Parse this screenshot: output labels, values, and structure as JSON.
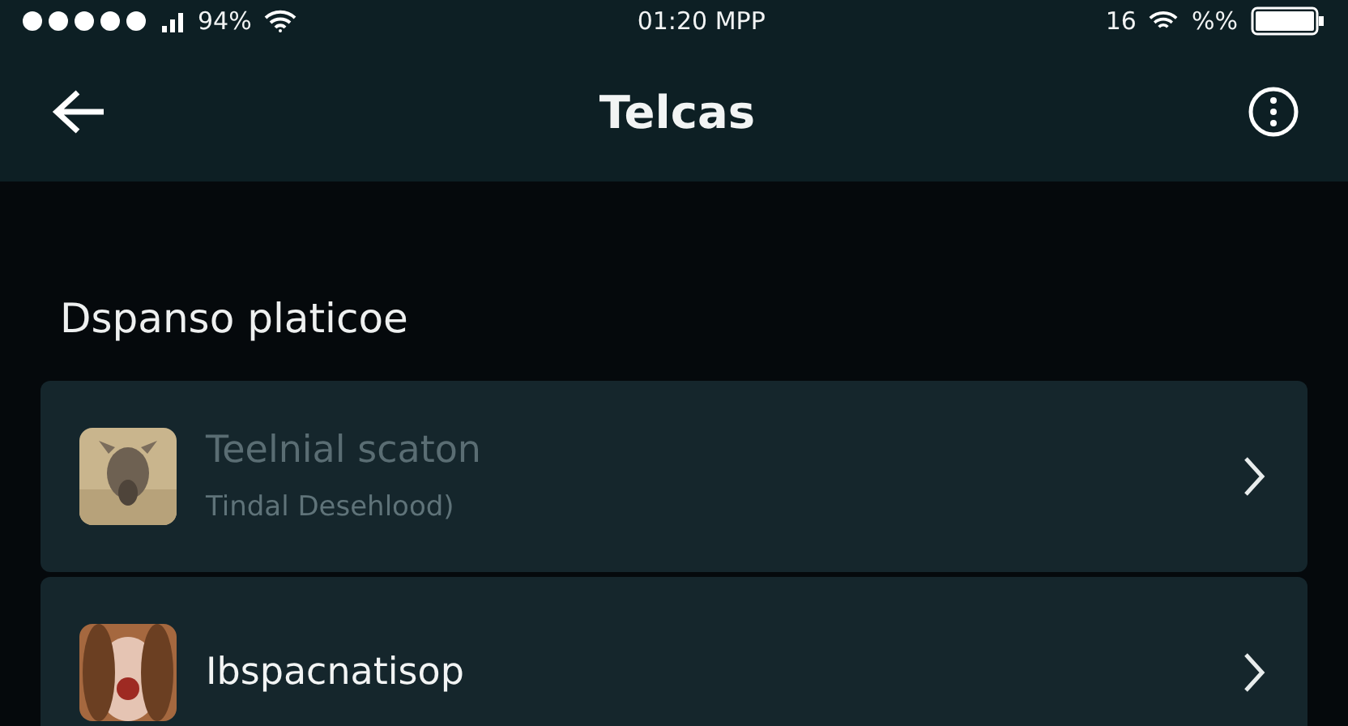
{
  "status_bar": {
    "carrier_signal": "94%",
    "time": "01:20 MPP",
    "right_text": "16",
    "battery_text": "%%"
  },
  "header": {
    "title": "Telcas"
  },
  "section": {
    "title": "Dspanso platicoe"
  },
  "items": [
    {
      "title": "Teelnial scaton",
      "subtitle": "Tindal Desehlood)",
      "dimmed": true,
      "kind": "picture"
    },
    {
      "title": "Ibspacnatisop",
      "dimmed": false,
      "kind": "picture"
    }
  ]
}
